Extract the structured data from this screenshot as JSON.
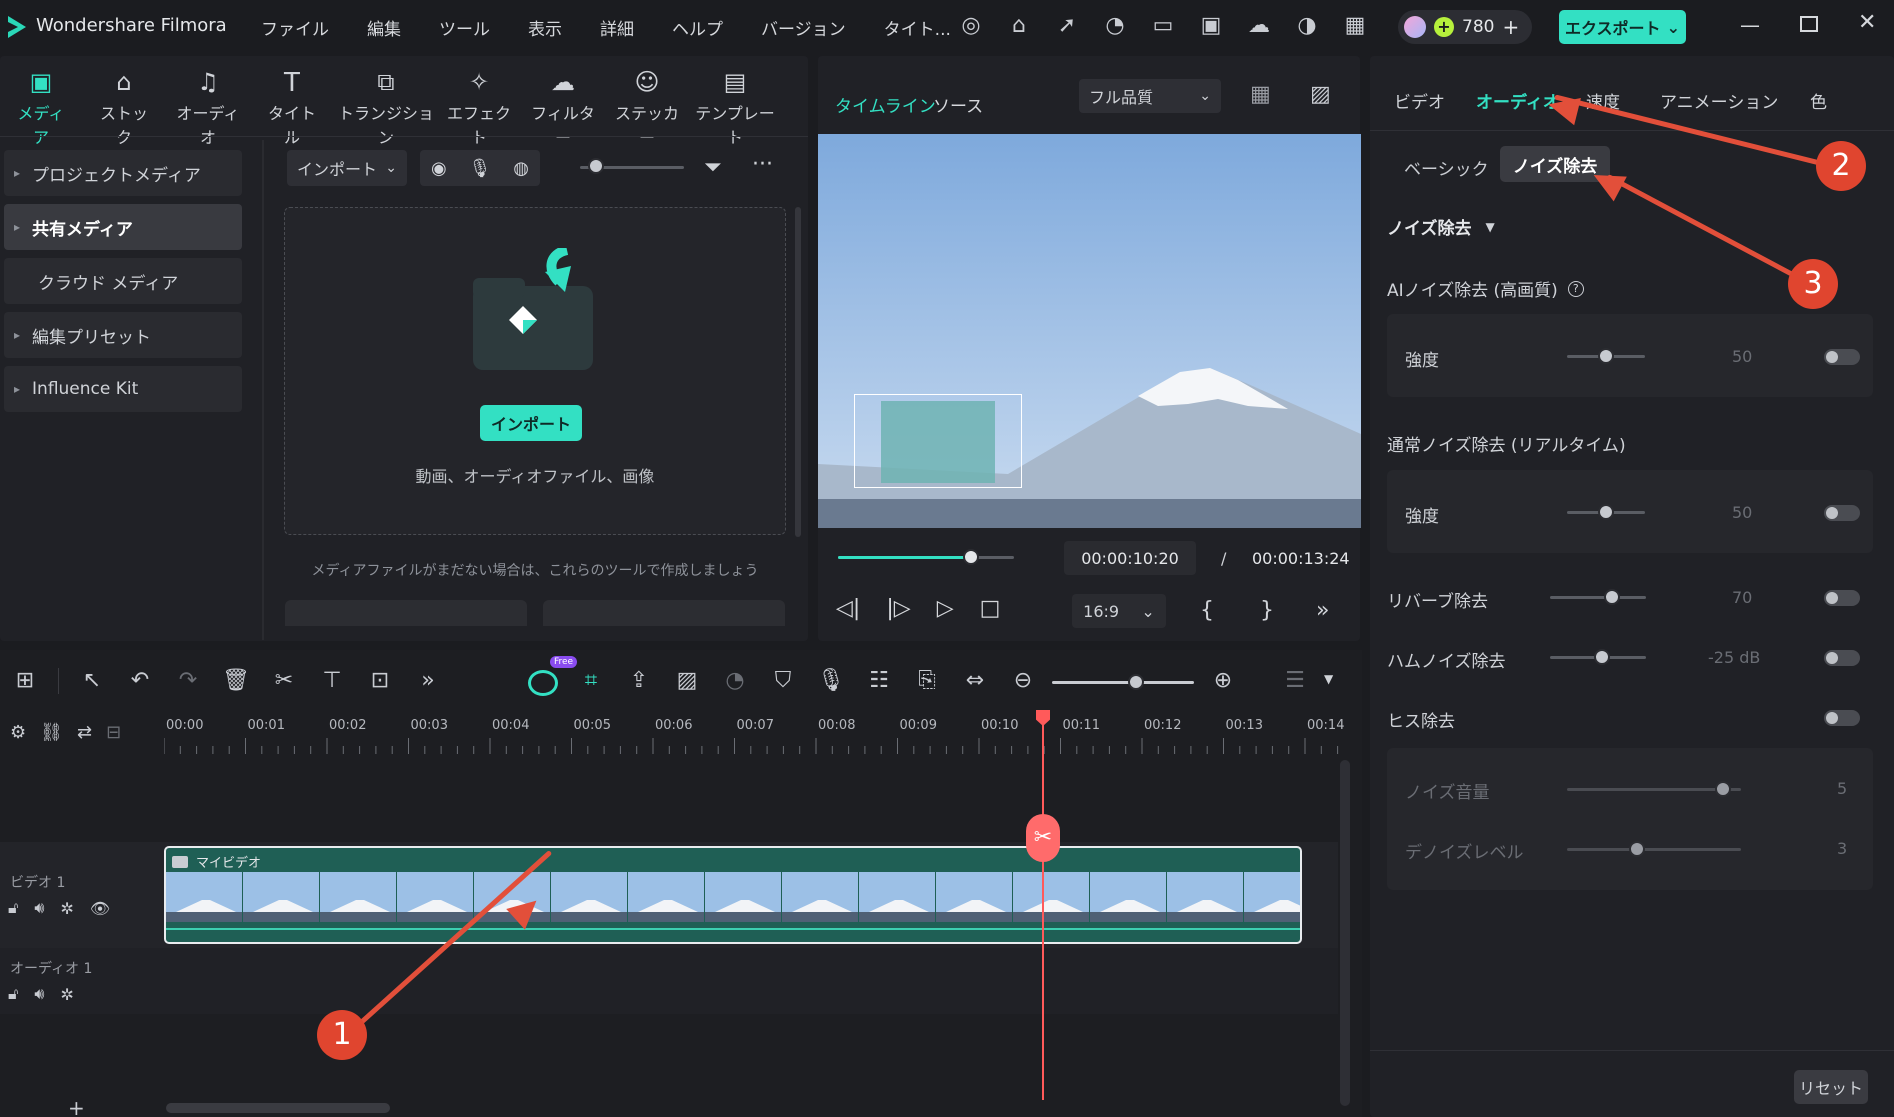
{
  "app": {
    "title": "Wondershare Filmora"
  },
  "menu": [
    "ファイル",
    "編集",
    "ツール",
    "表示",
    "詳細",
    "ヘルプ",
    "バージョン",
    "タイト..."
  ],
  "credits": "780",
  "export_label": "エクスポート",
  "toolbar_tabs": [
    "メディア",
    "ストック",
    "オーディオ",
    "タイトル",
    "トランジション",
    "エフェクト",
    "フィルター",
    "ステッカー",
    "テンプレート"
  ],
  "sidebar": [
    "プロジェクトメディア",
    "共有メディア",
    "クラウド メディア",
    "編集プリセット",
    "Influence Kit"
  ],
  "media": {
    "import_dropdown": "インポート",
    "import_button": "インポート",
    "import_hint": "動画、オーディオファイル、画像",
    "empty_note": "メディアファイルがまだない場合は、これらのツールで作成しましょう"
  },
  "preview": {
    "tab_timeline": "タイムライン",
    "tab_source": "ソース",
    "quality": "フル品質",
    "current_time": "00:00:10:20",
    "separator": "/",
    "total_time": "00:00:13:24",
    "aspect": "16:9",
    "progress": 0.76
  },
  "inspector": {
    "tabs": [
      "ビデオ",
      "オーディオ",
      "速度",
      "アニメーション",
      "色"
    ],
    "subtabs": [
      "ベーシック",
      "ノイズ除去"
    ],
    "section_title": "ノイズ除去",
    "ai_label": "AIノイズ除去 (高画質)",
    "ai_strength_label": "強度",
    "ai_strength_value": "50",
    "normal_label": "通常ノイズ除去 (リアルタイム)",
    "normal_strength_label": "強度",
    "normal_strength_value": "50",
    "reverb_label": "リバーブ除去",
    "reverb_value": "70",
    "hum_label": "ハムノイズ除去",
    "hum_value": "-25 dB",
    "hiss_label": "ヒス除去",
    "noise_vol_label": "ノイズ音量",
    "noise_vol_value": "5",
    "denoise_label": "デノイズレベル",
    "denoise_value": "3",
    "reset": "リセット"
  },
  "timeline": {
    "ruler": [
      "00:00",
      "00:01",
      "00:02",
      "00:03",
      "00:04",
      "00:05",
      "00:06",
      "00:07",
      "00:08",
      "00:09",
      "00:10",
      "00:11",
      "00:12",
      "00:13",
      "00:14"
    ],
    "video_track": "ビデオ 1",
    "audio_track": "オーディオ 1",
    "clip_name": "マイビデオ",
    "free_badge": "Free"
  },
  "annotations": [
    "1",
    "2",
    "3"
  ]
}
